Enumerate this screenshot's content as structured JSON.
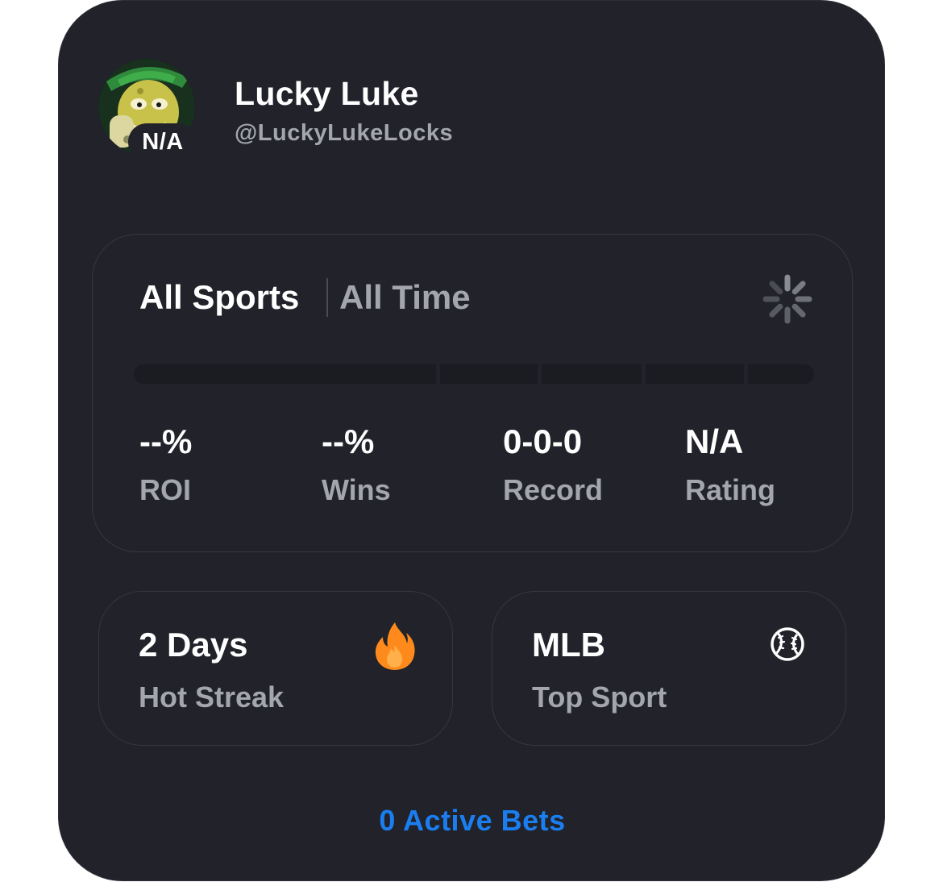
{
  "profile": {
    "display_name": "Lucky Luke",
    "handle": "@LuckyLukeLocks",
    "rating_badge": "N/A"
  },
  "stats": {
    "sport_filter": "All Sports",
    "time_filter": "All Time",
    "items": [
      {
        "value": "--%",
        "label": "ROI"
      },
      {
        "value": "--%",
        "label": "Wins"
      },
      {
        "value": "0-0-0",
        "label": "Record"
      },
      {
        "value": "N/A",
        "label": "Rating"
      }
    ]
  },
  "tiles": {
    "streak": {
      "value": "2 Days",
      "label": "Hot Streak",
      "icon": "fire-icon"
    },
    "top_sport": {
      "value": "MLB",
      "label": "Top Sport",
      "icon": "baseball-icon"
    }
  },
  "footer": {
    "active_bets": "0 Active Bets"
  },
  "colors": {
    "card_bg": "#21222a",
    "muted_text": "#a4a6ae",
    "accent_blue": "#1a7ef0",
    "fire_orange": "#ff8a1c"
  }
}
